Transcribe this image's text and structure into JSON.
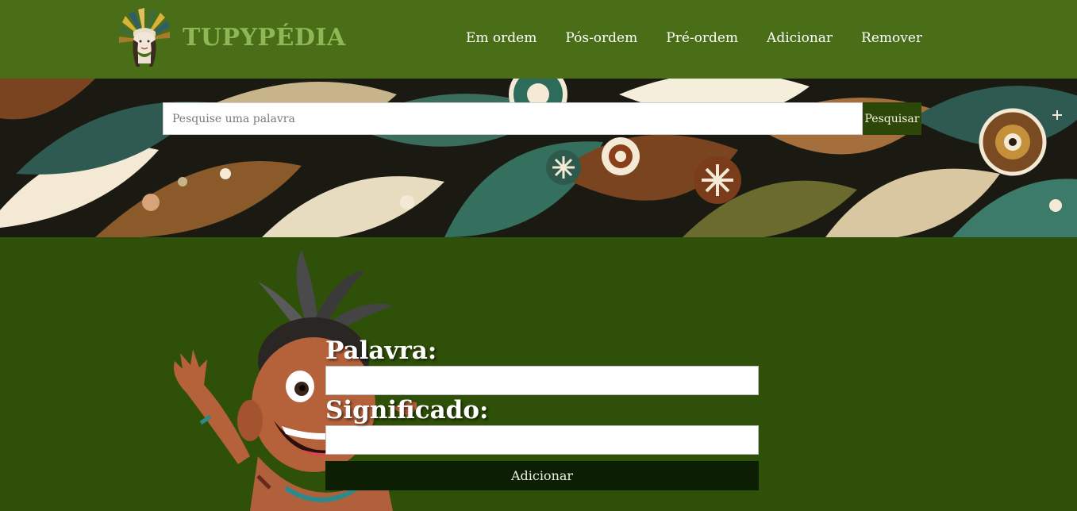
{
  "header": {
    "brand": "TUPYPÉDIA",
    "logo_icon": "indigenous-headdress-logo",
    "nav": [
      {
        "label": "Em ordem"
      },
      {
        "label": "Pós-ordem"
      },
      {
        "label": "Pré-ordem"
      },
      {
        "label": "Adicionar"
      },
      {
        "label": "Remover"
      }
    ]
  },
  "search": {
    "placeholder": "Pesquise uma palavra",
    "button_label": "Pesquisar"
  },
  "form": {
    "word_label": "Palavra:",
    "word_value": "",
    "meaning_label": "Significado:",
    "meaning_value": "",
    "submit_label": "Adicionar"
  },
  "colors": {
    "header_bg": "#4a6e17",
    "brand": "#8fb756",
    "main_bg": "#2f5008",
    "button_dark": "#0c1f04"
  }
}
